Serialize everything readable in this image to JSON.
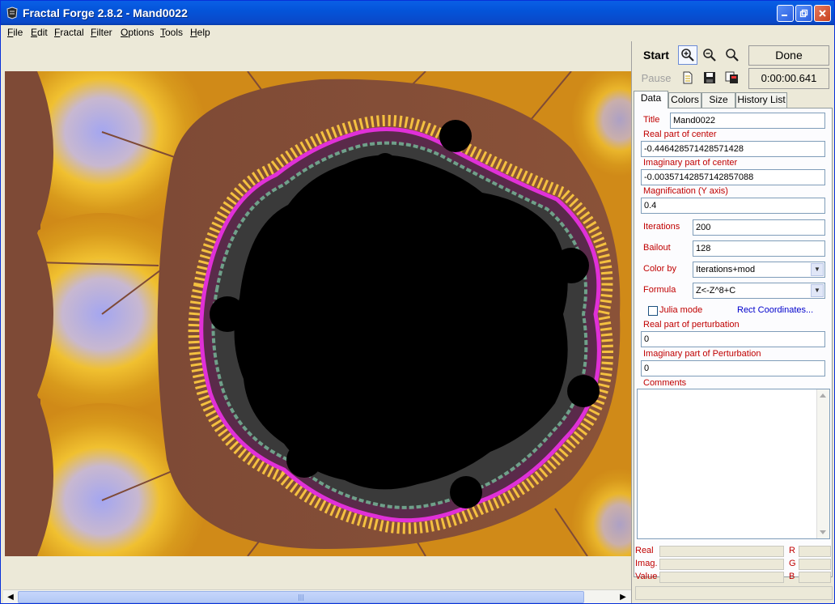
{
  "window": {
    "title": "Fractal Forge 2.8.2 - Mand0022",
    "buttons": {
      "minimize": "minimize-icon",
      "maximize": "maximize-icon",
      "close": "close-icon"
    }
  },
  "menu": [
    {
      "label": "File"
    },
    {
      "label": "Edit"
    },
    {
      "label": "Fractal"
    },
    {
      "label": "Filter"
    },
    {
      "label": "Options"
    },
    {
      "label": "Tools"
    },
    {
      "label": "Help"
    }
  ],
  "toolbar": {
    "start_label": "Start",
    "pause_label": "Pause",
    "status": "Done",
    "elapsed": "0:00:00.641",
    "tools": [
      "zoom-in-icon",
      "zoom-out-icon",
      "zoom-icon",
      "new-document-icon",
      "save-icon",
      "copy-icon"
    ]
  },
  "tabs": [
    {
      "label": "Data",
      "active": true
    },
    {
      "label": "Colors"
    },
    {
      "label": "Size"
    },
    {
      "label": "History List"
    }
  ],
  "data_tab": {
    "title_label": "Title",
    "title_value": "Mand0022",
    "real_center_label": "Real part of center",
    "real_center_value": "-0.446428571428571428",
    "imag_center_label": "Imaginary part of center",
    "imag_center_value": "-0.00357142857142857088",
    "magnification_label": "Magnification (Y axis)",
    "magnification_value": "0.4",
    "iterations_label": "Iterations",
    "iterations_value": "200",
    "bailout_label": "Bailout",
    "bailout_value": "128",
    "colorby_label": "Color by",
    "colorby_value": "Iterations+mod",
    "formula_label": "Formula",
    "formula_value": "Z<-Z^8+C",
    "julia_label": "Julia mode",
    "julia_checked": false,
    "rect_link": "Rect Coordinates...",
    "real_pert_label": "Real part of perturbation",
    "real_pert_value": "0",
    "imag_pert_label": "Imaginary part of Perturbation",
    "imag_pert_value": "0",
    "comments_label": "Comments",
    "comments_value": ""
  },
  "readout": {
    "real_label": "Real",
    "imag_label": "Imag.",
    "value_label": "Value",
    "r_label": "R",
    "g_label": "G",
    "b_label": "B"
  },
  "colors": {
    "titlebar": "#0454d9",
    "label_red": "#c00000",
    "link_blue": "#0000cc",
    "fractal_outer": "#d08a18",
    "fractal_brown": "#7e4a36",
    "fractal_lavender": "#a4a6f0",
    "fractal_magenta": "#e030d8",
    "fractal_interior": "#000000"
  }
}
